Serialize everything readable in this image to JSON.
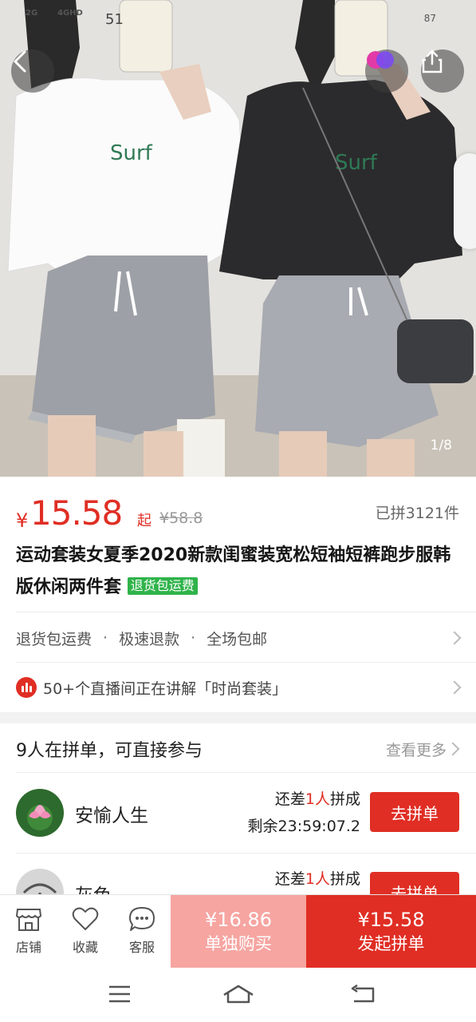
{
  "status": {
    "network1": "2G",
    "network2": "4GHD",
    "time": "51",
    "battery": "87"
  },
  "hero": {
    "pager": "1/8"
  },
  "product": {
    "currency": "¥",
    "price": "15.58",
    "price_suffix": "起",
    "original_price": "¥58.8",
    "sold": "已拼3121件",
    "title": "运动套装女夏季2020新款闺蜜装宽松短袖短裤跑步服韩版休闲两件套",
    "title_tag": "退货包运费"
  },
  "services": {
    "items": [
      "退货包运费",
      "极速退款",
      "全场包邮"
    ],
    "separator": "·"
  },
  "live": {
    "text": "50+个直播间正在讲解「时尚套装」"
  },
  "group": {
    "heading": "9人在拼单，可直接参与",
    "more": "查看更多",
    "items": [
      {
        "name": "安愉人生",
        "need_prefix": "还差",
        "need_count": "1人",
        "need_suffix": "拼成",
        "remain": "剩余23:59:07.2",
        "button": "去拼单"
      },
      {
        "name": "灰色",
        "need_prefix": "还差",
        "need_count": "1人",
        "need_suffix": "拼成",
        "remain": "",
        "button": "去拼单"
      }
    ]
  },
  "bottom": {
    "store": "店铺",
    "favorite": "收藏",
    "service": "客服",
    "alone_price": "¥16.86",
    "alone_label": "单独购买",
    "group_price": "¥15.58",
    "group_label": "发起拼单"
  },
  "colors": {
    "accent": "#e02e24",
    "accent_light": "#f6a5a1",
    "tag_green": "#2fb34a"
  }
}
